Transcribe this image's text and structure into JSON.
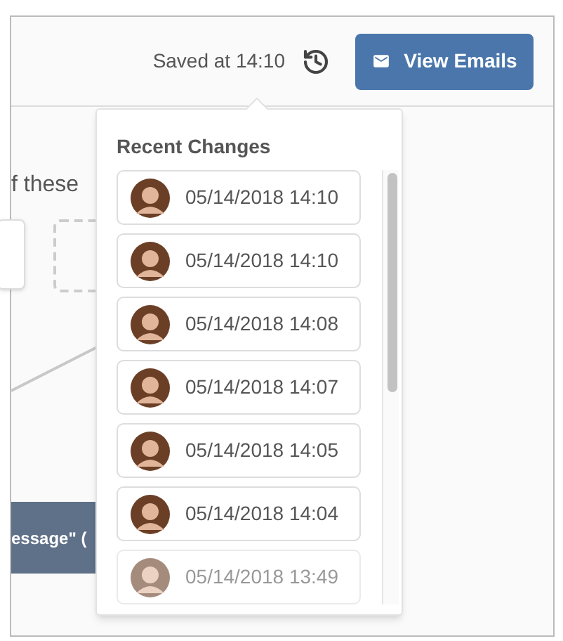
{
  "header": {
    "saved_text": "Saved at 14:10",
    "button": "View Emails"
  },
  "background": {
    "text": "f these",
    "bar_text": "essage\" ("
  },
  "popover": {
    "title": "Recent Changes",
    "items": [
      {
        "time": "05/14/2018 14:10",
        "faded": false
      },
      {
        "time": "05/14/2018 14:10",
        "faded": false
      },
      {
        "time": "05/14/2018 14:08",
        "faded": false
      },
      {
        "time": "05/14/2018 14:07",
        "faded": false
      },
      {
        "time": "05/14/2018 14:05",
        "faded": false
      },
      {
        "time": "05/14/2018 14:04",
        "faded": false
      },
      {
        "time": "05/14/2018 13:49",
        "faded": true
      }
    ]
  }
}
